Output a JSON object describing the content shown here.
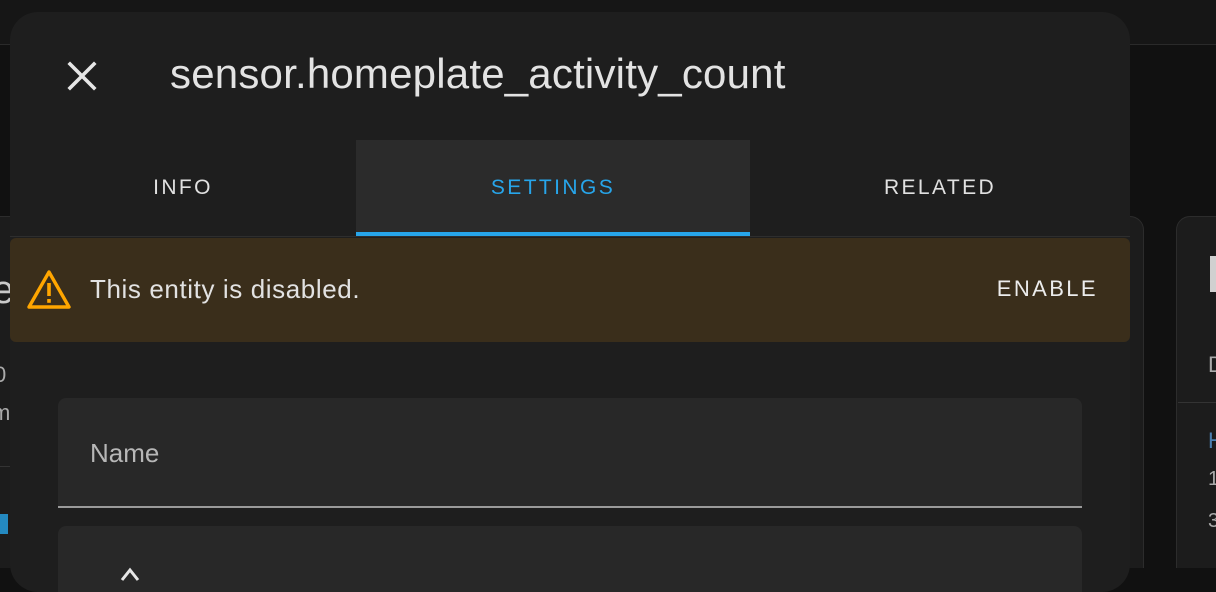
{
  "dialog": {
    "title": "sensor.homeplate_activity_count",
    "close_icon": "close-icon"
  },
  "tabs": [
    {
      "label": "INFO",
      "active": false
    },
    {
      "label": "SETTINGS",
      "active": true
    },
    {
      "label": "RELATED",
      "active": false
    }
  ],
  "warning": {
    "icon": "alert-triangle-icon",
    "message": "This entity is disabled.",
    "action_label": "ENABLE"
  },
  "form": {
    "name_field": {
      "label": "Name",
      "value": ""
    }
  },
  "background": {
    "left_fragments": [
      "e",
      "0",
      "m"
    ],
    "right_fragments": [
      "D",
      "H",
      "1",
      "3"
    ]
  },
  "colors": {
    "accent": "#27a5ea",
    "warning_bg": "#3a2e1b",
    "warning_icon": "#ffa600",
    "dialog_bg": "#1e1e1e"
  }
}
